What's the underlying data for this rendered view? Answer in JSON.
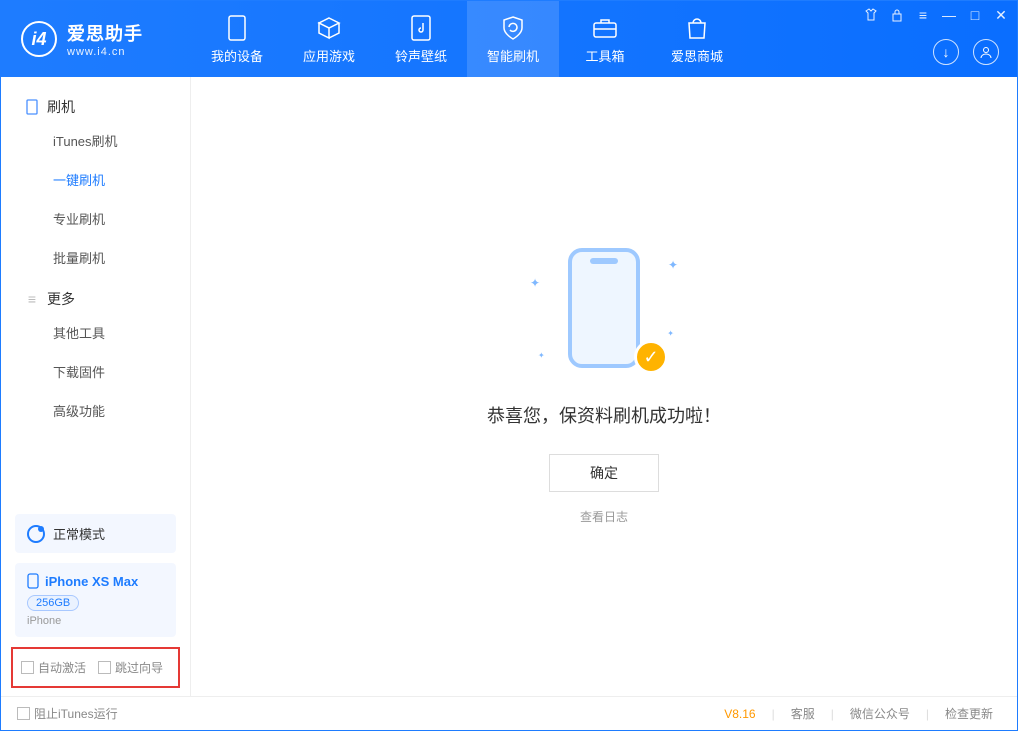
{
  "header": {
    "logo_title": "爱思助手",
    "logo_sub": "www.i4.cn",
    "tabs": [
      {
        "label": "我的设备"
      },
      {
        "label": "应用游戏"
      },
      {
        "label": "铃声壁纸"
      },
      {
        "label": "智能刷机"
      },
      {
        "label": "工具箱"
      },
      {
        "label": "爱思商城"
      }
    ],
    "active_tab_index": 3
  },
  "sidebar": {
    "group1_label": "刷机",
    "group1_items": [
      {
        "label": "iTunes刷机"
      },
      {
        "label": "一键刷机"
      },
      {
        "label": "专业刷机"
      },
      {
        "label": "批量刷机"
      }
    ],
    "group1_active_index": 1,
    "group2_label": "更多",
    "group2_items": [
      {
        "label": "其他工具"
      },
      {
        "label": "下载固件"
      },
      {
        "label": "高级功能"
      }
    ],
    "mode_label": "正常模式",
    "device_name": "iPhone XS Max",
    "device_capacity": "256GB",
    "device_type": "iPhone",
    "checkbox_auto_activate": "自动激活",
    "checkbox_skip_wizard": "跳过向导"
  },
  "main": {
    "success_text": "恭喜您，保资料刷机成功啦！",
    "ok_button": "确定",
    "view_log": "查看日志"
  },
  "footer": {
    "block_itunes": "阻止iTunes运行",
    "version": "V8.16",
    "links": [
      {
        "label": "客服"
      },
      {
        "label": "微信公众号"
      },
      {
        "label": "检查更新"
      }
    ]
  }
}
